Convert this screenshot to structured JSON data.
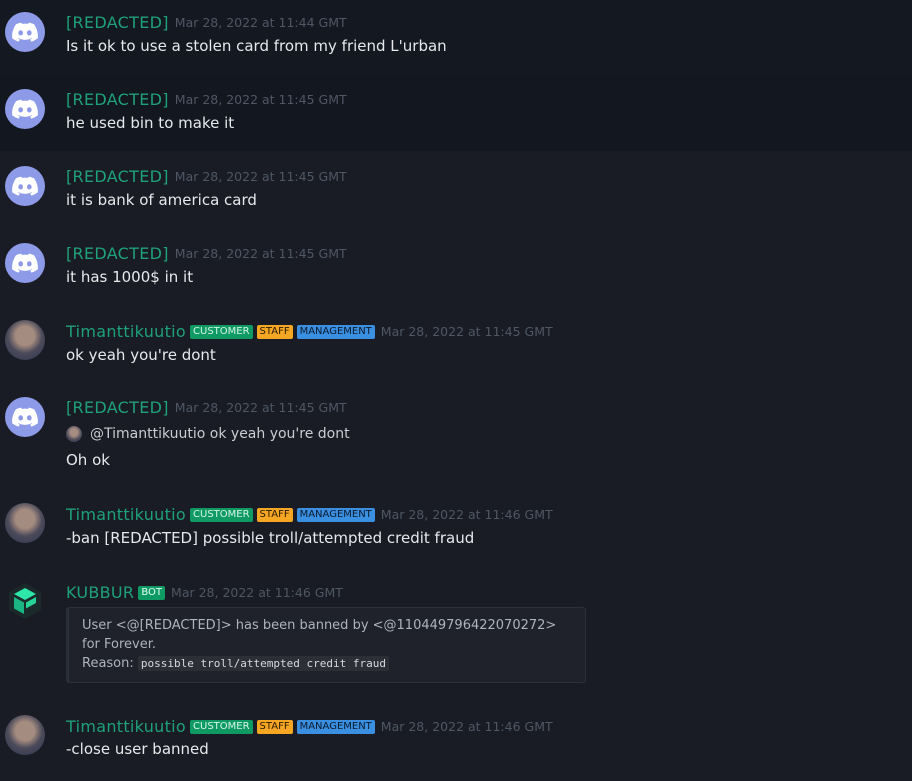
{
  "messages": [
    {
      "user": "[REDACTED]",
      "time": "Mar 28, 2022 at 11:44 GMT",
      "text": "Is it ok to use a stolen card from my friend L'urban"
    },
    {
      "user": "[REDACTED]",
      "time": "Mar 28, 2022 at 11:45 GMT",
      "text": "he used bin to make it"
    },
    {
      "user": "[REDACTED]",
      "time": "Mar 28, 2022 at 11:45 GMT",
      "text": "it is bank of america card"
    },
    {
      "user": "[REDACTED]",
      "time": "Mar 28, 2022 at 11:45 GMT",
      "text": "it has 1000$ in it"
    },
    {
      "user": "Timanttikuutio",
      "badges": [
        "CUSTOMER",
        "STAFF",
        "MANAGEMENT"
      ],
      "time": "Mar 28, 2022 at 11:45 GMT",
      "text": "ok yeah you're dont"
    },
    {
      "user": "[REDACTED]",
      "time": "Mar 28, 2022 at 11:45 GMT",
      "reply": "@Timanttikuutio ok yeah you're dont",
      "text": "Oh ok"
    },
    {
      "user": "Timanttikuutio",
      "badges": [
        "CUSTOMER",
        "STAFF",
        "MANAGEMENT"
      ],
      "time": "Mar 28, 2022 at 11:46 GMT",
      "text": "-ban [REDACTED] possible troll/attempted credit fraud"
    },
    {
      "user": "KUBBUR",
      "badges": [
        "BOT"
      ],
      "time": "Mar 28, 2022 at 11:46 GMT",
      "embed": {
        "line1": "User <@[REDACTED]> has been banned by <@110449796422070272>",
        "line2": "for Forever.",
        "reason_label": "Reason:",
        "reason": "possible troll/attempted credit fraud"
      }
    },
    {
      "user": "Timanttikuutio",
      "badges": [
        "CUSTOMER",
        "STAFF",
        "MANAGEMENT"
      ],
      "time": "Mar 28, 2022 at 11:46 GMT",
      "text": "-close user banned"
    }
  ],
  "colors": {
    "username": "#1fa07c",
    "customer": "#0f9a64",
    "staff": "#f5a623",
    "management": "#3b8fe0"
  },
  "icons": {
    "discord_avatar": "discord-logo-icon",
    "kubbur_avatar": "kubbur-logo-icon"
  }
}
